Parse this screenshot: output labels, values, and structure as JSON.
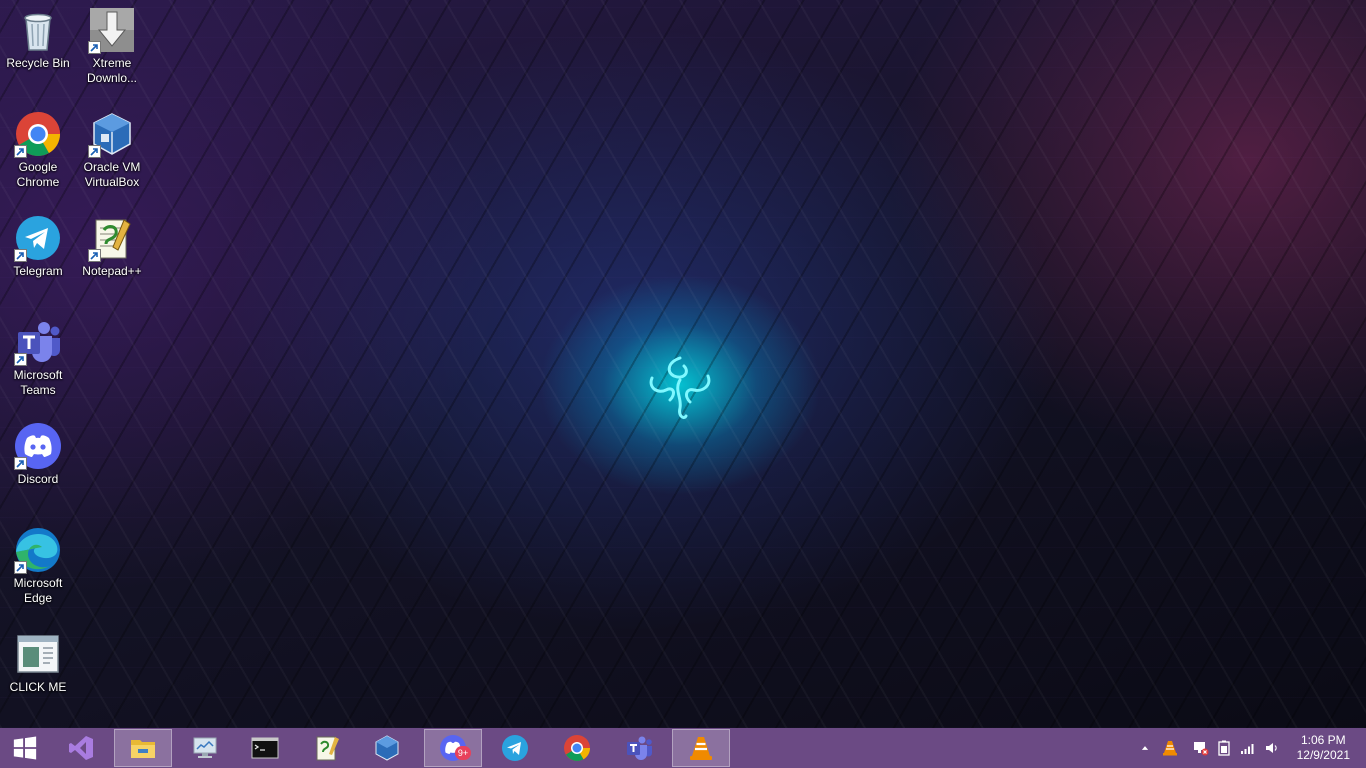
{
  "desktop": {
    "icons": [
      {
        "id": "recycle-bin",
        "label": "Recycle Bin",
        "shortcut": false
      },
      {
        "id": "xtreme",
        "label": "Xtreme Downlo...",
        "shortcut": true
      },
      {
        "id": "chrome",
        "label": "Google Chrome",
        "shortcut": true
      },
      {
        "id": "virtualbox",
        "label": "Oracle VM VirtualBox",
        "shortcut": true
      },
      {
        "id": "telegram",
        "label": "Telegram",
        "shortcut": true
      },
      {
        "id": "notepadpp",
        "label": "Notepad++",
        "shortcut": true
      },
      {
        "id": "teams",
        "label": "Microsoft Teams",
        "shortcut": true
      },
      {
        "id": "discord",
        "label": "Discord",
        "shortcut": true
      },
      {
        "id": "edge",
        "label": "Microsoft Edge",
        "shortcut": true
      },
      {
        "id": "clickme",
        "label": "CLICK ME",
        "shortcut": false
      }
    ]
  },
  "taskbar": {
    "apps": [
      {
        "id": "start",
        "icon": "windows-logo-icon"
      },
      {
        "id": "visual-studio",
        "icon": "visual-studio-icon"
      },
      {
        "id": "file-explorer",
        "icon": "folder-icon",
        "active": true
      },
      {
        "id": "control-panel",
        "icon": "monitor-icon"
      },
      {
        "id": "command-prompt",
        "icon": "terminal-icon"
      },
      {
        "id": "notepadpp",
        "icon": "notepadpp-icon"
      },
      {
        "id": "virtualbox",
        "icon": "virtualbox-icon"
      },
      {
        "id": "discord",
        "icon": "discord-icon",
        "active": true,
        "badge": "9+"
      },
      {
        "id": "telegram",
        "icon": "telegram-icon"
      },
      {
        "id": "chrome",
        "icon": "chrome-icon"
      },
      {
        "id": "teams",
        "icon": "teams-icon"
      },
      {
        "id": "vlc",
        "icon": "vlc-icon",
        "active": true
      }
    ],
    "tray": {
      "icons": [
        "chevron-up-icon",
        "vlc-tray-icon",
        "network-x-icon",
        "battery-icon",
        "signal-icon",
        "volume-icon"
      ],
      "time": "1:06 PM",
      "date": "12/9/2021"
    }
  },
  "colors": {
    "taskbar": "#6b4a84",
    "accent": "#00e0e8"
  }
}
